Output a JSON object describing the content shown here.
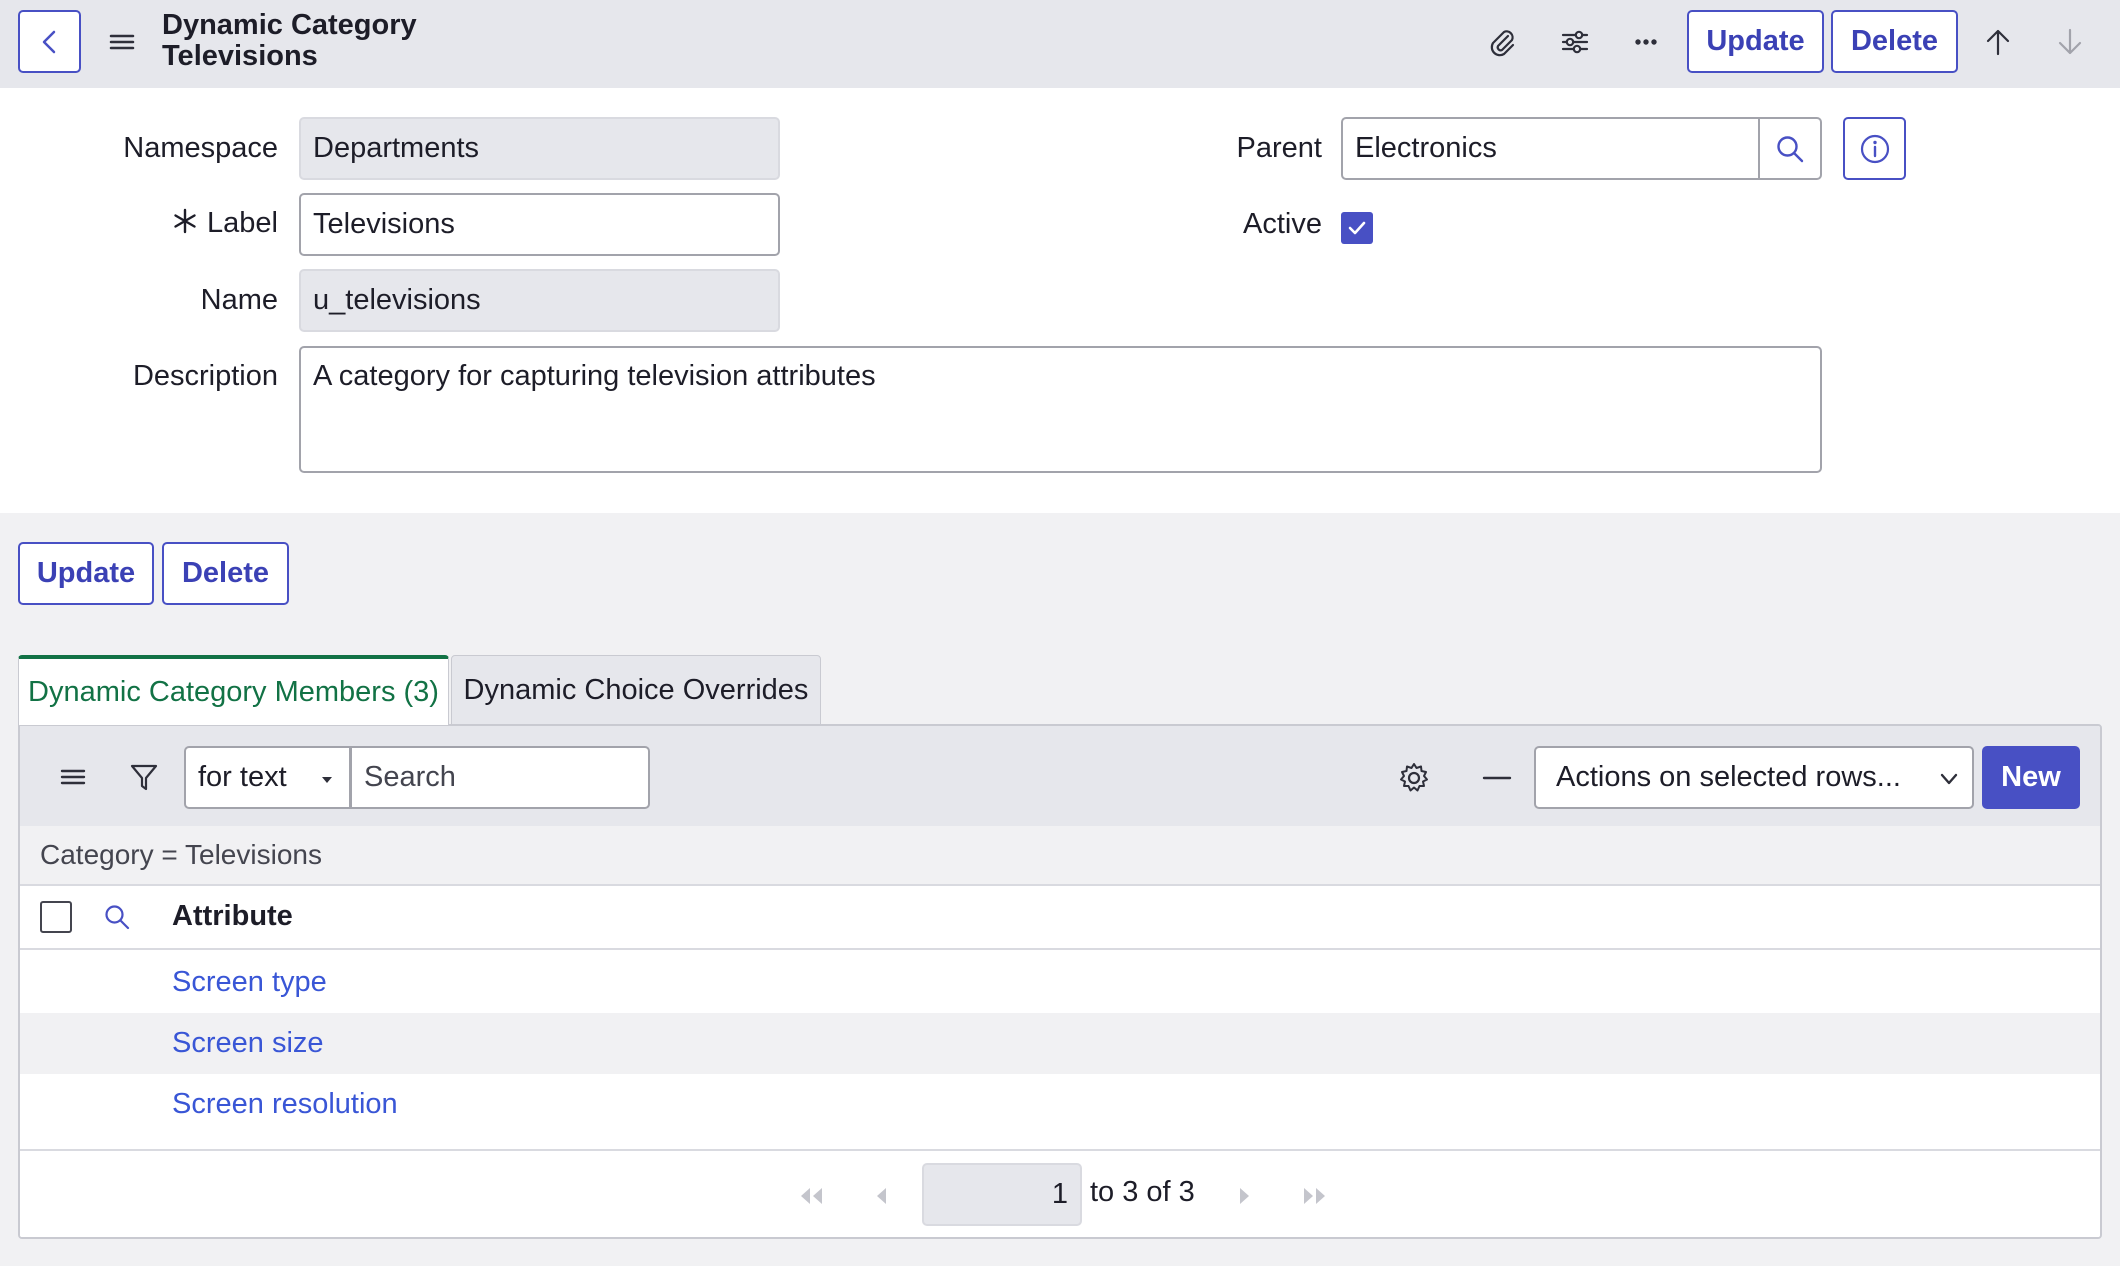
{
  "header": {
    "title_line1": "Dynamic Category",
    "title_line2": "Televisions",
    "update_label": "Update",
    "delete_label": "Delete"
  },
  "form": {
    "namespace_label": "Namespace",
    "namespace_value": "Departments",
    "label_label": "Label",
    "label_value": "Televisions",
    "name_label": "Name",
    "name_value": "u_televisions",
    "description_label": "Description",
    "description_value": "A category for capturing television attributes",
    "parent_label": "Parent",
    "parent_value": "Electronics",
    "active_label": "Active",
    "active_checked": true
  },
  "buttons": {
    "update_label": "Update",
    "delete_label": "Delete"
  },
  "tabs": [
    {
      "label": "Dynamic Category Members (3)",
      "active": true
    },
    {
      "label": "Dynamic Choice Overrides",
      "active": false
    }
  ],
  "list": {
    "search_mode": "for text",
    "search_placeholder": "Search",
    "actions_label": "Actions on selected rows...",
    "new_label": "New",
    "filter_text": "Category = Televisions",
    "column_header": "Attribute",
    "rows": [
      "Screen type",
      "Screen size",
      "Screen resolution"
    ],
    "pagination": {
      "current": "1",
      "range_text": "to 3 of 3"
    }
  },
  "colors": {
    "accent": "#4850c4",
    "tab_active": "#127245",
    "link": "#3956d6",
    "header_bg": "#e6e7ec"
  }
}
